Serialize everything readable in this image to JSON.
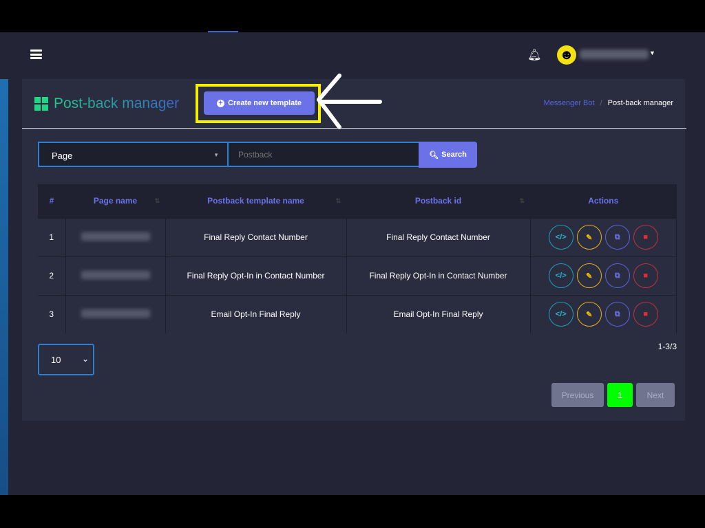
{
  "navbar": {
    "menu_icon": "hamburger-icon",
    "bell_icon": "bell-icon",
    "avatar": "smiley-avatar"
  },
  "header": {
    "title": "Post-back manager",
    "create_button": "Create new template"
  },
  "breadcrumb": {
    "parent": "Messenger Bot",
    "current": "Post-back manager"
  },
  "filters": {
    "page_select": "Page",
    "postback_placeholder": "Postback",
    "search_button": "Search"
  },
  "table": {
    "columns": [
      "#",
      "Page name",
      "Postback template name",
      "Postback id",
      "Actions"
    ],
    "rows": [
      {
        "num": "1",
        "template": "Final Reply Contact Number",
        "postback_id": "Final Reply Contact Number"
      },
      {
        "num": "2",
        "template": "Final Reply Opt-In in Contact Number",
        "postback_id": "Final Reply Opt-In in Contact Number"
      },
      {
        "num": "3",
        "template": "Email Opt-In Final Reply",
        "postback_id": "Email Opt-In Final Reply"
      }
    ]
  },
  "pagination": {
    "page_length": "10",
    "count": "1-3/3",
    "previous": "Previous",
    "current": "1",
    "next": "Next"
  },
  "colors": {
    "accent": "#6b72e8",
    "highlight": "#f5ef00",
    "active_page": "#00ff00"
  }
}
